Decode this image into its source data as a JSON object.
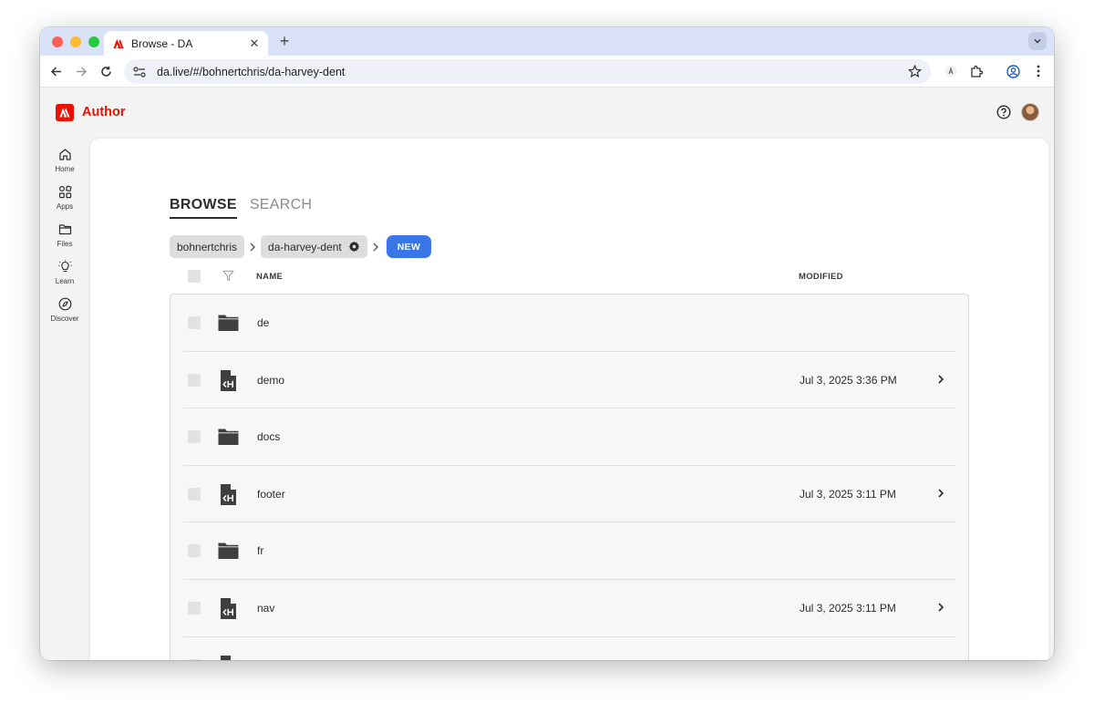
{
  "browser": {
    "tab_title": "Browse - DA",
    "url": "da.live/#/bohnertchris/da-harvey-dent"
  },
  "app": {
    "brand": "Author",
    "nav": [
      {
        "label": "Home",
        "icon": "home-icon"
      },
      {
        "label": "Apps",
        "icon": "apps-icon"
      },
      {
        "label": "Files",
        "icon": "folder-icon"
      },
      {
        "label": "Learn",
        "icon": "lightbulb-icon"
      },
      {
        "label": "Discover",
        "icon": "compass-icon"
      }
    ]
  },
  "view_tabs": {
    "browse": "BROWSE",
    "search": "SEARCH"
  },
  "breadcrumbs": {
    "org": "bohnertchris",
    "site": "da-harvey-dent",
    "new_button": "NEW"
  },
  "list": {
    "columns": {
      "name": "NAME",
      "modified": "MODIFIED"
    },
    "rows": [
      {
        "name": "de",
        "type": "folder",
        "modified": ""
      },
      {
        "name": "demo",
        "type": "document",
        "modified": "Jul 3, 2025 3:36 PM"
      },
      {
        "name": "docs",
        "type": "folder",
        "modified": ""
      },
      {
        "name": "footer",
        "type": "document",
        "modified": "Jul 3, 2025 3:11 PM"
      },
      {
        "name": "fr",
        "type": "folder",
        "modified": ""
      },
      {
        "name": "nav",
        "type": "document",
        "modified": "Jul 3, 2025 3:11 PM"
      }
    ]
  },
  "colors": {
    "brand_red": "#eb1000",
    "accent_blue": "#3b75ea",
    "tab_strip": "#dae2f7"
  }
}
